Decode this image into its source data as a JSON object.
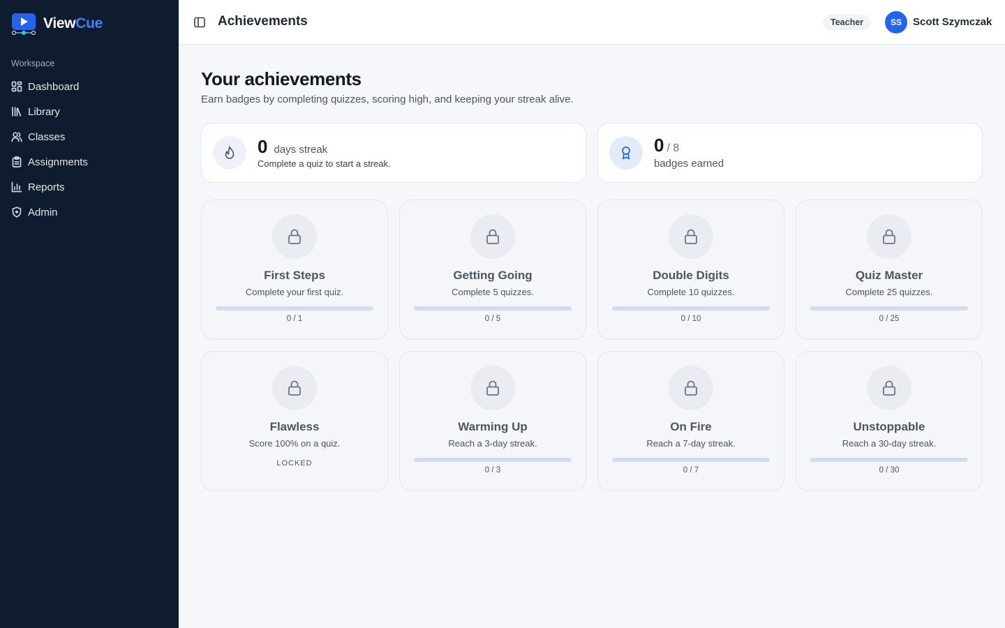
{
  "brand": {
    "name_part1": "View",
    "name_part2": "Cue",
    "accent": "#3b82f6"
  },
  "sidebar": {
    "section_label": "Workspace",
    "items": [
      {
        "label": "Dashboard",
        "icon": "dashboard-icon"
      },
      {
        "label": "Library",
        "icon": "library-icon"
      },
      {
        "label": "Classes",
        "icon": "users-icon"
      },
      {
        "label": "Assignments",
        "icon": "clipboard-icon"
      },
      {
        "label": "Reports",
        "icon": "bar-chart-icon"
      },
      {
        "label": "Admin",
        "icon": "shield-icon"
      }
    ]
  },
  "header": {
    "title": "Achievements",
    "role": "Teacher",
    "user_initials": "SS",
    "user_name": "Scott Szymczak"
  },
  "main": {
    "heading": "Your achievements",
    "subtitle": "Earn badges by completing quizzes, scoring high, and keeping your streak alive.",
    "streak": {
      "value": "0",
      "unit": "days streak",
      "hint": "Complete a quiz to start a streak.",
      "icon": "flame-icon"
    },
    "badges_earned": {
      "value": "0",
      "total": "/ 8",
      "label": "badges earned",
      "icon": "award-icon"
    },
    "badges": [
      {
        "name": "First Steps",
        "desc": "Complete your first quiz.",
        "progress": "0 / 1",
        "fraction": 0,
        "locked": false
      },
      {
        "name": "Getting Going",
        "desc": "Complete 5 quizzes.",
        "progress": "0 / 5",
        "fraction": 0,
        "locked": false
      },
      {
        "name": "Double Digits",
        "desc": "Complete 10 quizzes.",
        "progress": "0 / 10",
        "fraction": 0,
        "locked": false
      },
      {
        "name": "Quiz Master",
        "desc": "Complete 25 quizzes.",
        "progress": "0 / 25",
        "fraction": 0,
        "locked": false
      },
      {
        "name": "Flawless",
        "desc": "Score 100% on a quiz.",
        "status": "LOCKED",
        "locked": true
      },
      {
        "name": "Warming Up",
        "desc": "Reach a 3-day streak.",
        "progress": "0 / 3",
        "fraction": 0,
        "locked": false
      },
      {
        "name": "On Fire",
        "desc": "Reach a 7-day streak.",
        "progress": "0 / 7",
        "fraction": 0,
        "locked": false
      },
      {
        "name": "Unstoppable",
        "desc": "Reach a 30-day streak.",
        "progress": "0 / 30",
        "fraction": 0,
        "locked": false
      }
    ]
  },
  "colors": {
    "sidebar_bg": "#0f1b2e",
    "primary": "#2563eb",
    "progress_track": "#d3ddf0"
  }
}
